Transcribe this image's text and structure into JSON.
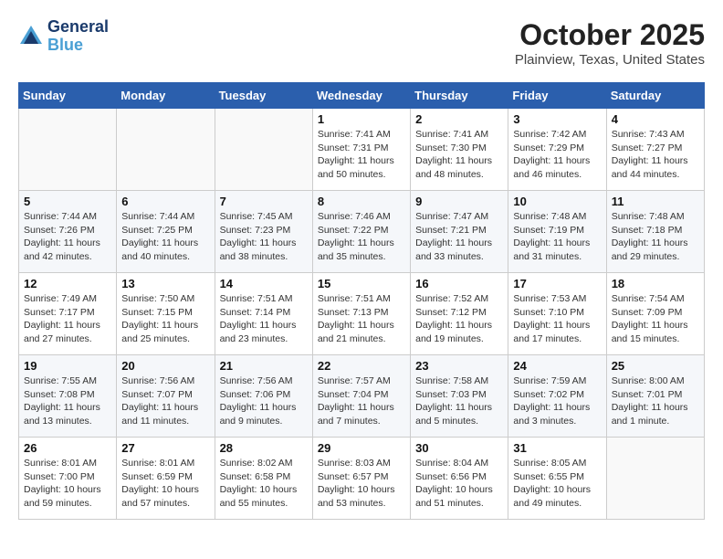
{
  "header": {
    "logo_line1": "General",
    "logo_line2": "Blue",
    "month_title": "October 2025",
    "location": "Plainview, Texas, United States"
  },
  "weekdays": [
    "Sunday",
    "Monday",
    "Tuesday",
    "Wednesday",
    "Thursday",
    "Friday",
    "Saturday"
  ],
  "weeks": [
    [
      {
        "num": "",
        "info": ""
      },
      {
        "num": "",
        "info": ""
      },
      {
        "num": "",
        "info": ""
      },
      {
        "num": "1",
        "info": "Sunrise: 7:41 AM\nSunset: 7:31 PM\nDaylight: 11 hours and 50 minutes."
      },
      {
        "num": "2",
        "info": "Sunrise: 7:41 AM\nSunset: 7:30 PM\nDaylight: 11 hours and 48 minutes."
      },
      {
        "num": "3",
        "info": "Sunrise: 7:42 AM\nSunset: 7:29 PM\nDaylight: 11 hours and 46 minutes."
      },
      {
        "num": "4",
        "info": "Sunrise: 7:43 AM\nSunset: 7:27 PM\nDaylight: 11 hours and 44 minutes."
      }
    ],
    [
      {
        "num": "5",
        "info": "Sunrise: 7:44 AM\nSunset: 7:26 PM\nDaylight: 11 hours and 42 minutes."
      },
      {
        "num": "6",
        "info": "Sunrise: 7:44 AM\nSunset: 7:25 PM\nDaylight: 11 hours and 40 minutes."
      },
      {
        "num": "7",
        "info": "Sunrise: 7:45 AM\nSunset: 7:23 PM\nDaylight: 11 hours and 38 minutes."
      },
      {
        "num": "8",
        "info": "Sunrise: 7:46 AM\nSunset: 7:22 PM\nDaylight: 11 hours and 35 minutes."
      },
      {
        "num": "9",
        "info": "Sunrise: 7:47 AM\nSunset: 7:21 PM\nDaylight: 11 hours and 33 minutes."
      },
      {
        "num": "10",
        "info": "Sunrise: 7:48 AM\nSunset: 7:19 PM\nDaylight: 11 hours and 31 minutes."
      },
      {
        "num": "11",
        "info": "Sunrise: 7:48 AM\nSunset: 7:18 PM\nDaylight: 11 hours and 29 minutes."
      }
    ],
    [
      {
        "num": "12",
        "info": "Sunrise: 7:49 AM\nSunset: 7:17 PM\nDaylight: 11 hours and 27 minutes."
      },
      {
        "num": "13",
        "info": "Sunrise: 7:50 AM\nSunset: 7:15 PM\nDaylight: 11 hours and 25 minutes."
      },
      {
        "num": "14",
        "info": "Sunrise: 7:51 AM\nSunset: 7:14 PM\nDaylight: 11 hours and 23 minutes."
      },
      {
        "num": "15",
        "info": "Sunrise: 7:51 AM\nSunset: 7:13 PM\nDaylight: 11 hours and 21 minutes."
      },
      {
        "num": "16",
        "info": "Sunrise: 7:52 AM\nSunset: 7:12 PM\nDaylight: 11 hours and 19 minutes."
      },
      {
        "num": "17",
        "info": "Sunrise: 7:53 AM\nSunset: 7:10 PM\nDaylight: 11 hours and 17 minutes."
      },
      {
        "num": "18",
        "info": "Sunrise: 7:54 AM\nSunset: 7:09 PM\nDaylight: 11 hours and 15 minutes."
      }
    ],
    [
      {
        "num": "19",
        "info": "Sunrise: 7:55 AM\nSunset: 7:08 PM\nDaylight: 11 hours and 13 minutes."
      },
      {
        "num": "20",
        "info": "Sunrise: 7:56 AM\nSunset: 7:07 PM\nDaylight: 11 hours and 11 minutes."
      },
      {
        "num": "21",
        "info": "Sunrise: 7:56 AM\nSunset: 7:06 PM\nDaylight: 11 hours and 9 minutes."
      },
      {
        "num": "22",
        "info": "Sunrise: 7:57 AM\nSunset: 7:04 PM\nDaylight: 11 hours and 7 minutes."
      },
      {
        "num": "23",
        "info": "Sunrise: 7:58 AM\nSunset: 7:03 PM\nDaylight: 11 hours and 5 minutes."
      },
      {
        "num": "24",
        "info": "Sunrise: 7:59 AM\nSunset: 7:02 PM\nDaylight: 11 hours and 3 minutes."
      },
      {
        "num": "25",
        "info": "Sunrise: 8:00 AM\nSunset: 7:01 PM\nDaylight: 11 hours and 1 minute."
      }
    ],
    [
      {
        "num": "26",
        "info": "Sunrise: 8:01 AM\nSunset: 7:00 PM\nDaylight: 10 hours and 59 minutes."
      },
      {
        "num": "27",
        "info": "Sunrise: 8:01 AM\nSunset: 6:59 PM\nDaylight: 10 hours and 57 minutes."
      },
      {
        "num": "28",
        "info": "Sunrise: 8:02 AM\nSunset: 6:58 PM\nDaylight: 10 hours and 55 minutes."
      },
      {
        "num": "29",
        "info": "Sunrise: 8:03 AM\nSunset: 6:57 PM\nDaylight: 10 hours and 53 minutes."
      },
      {
        "num": "30",
        "info": "Sunrise: 8:04 AM\nSunset: 6:56 PM\nDaylight: 10 hours and 51 minutes."
      },
      {
        "num": "31",
        "info": "Sunrise: 8:05 AM\nSunset: 6:55 PM\nDaylight: 10 hours and 49 minutes."
      },
      {
        "num": "",
        "info": ""
      }
    ]
  ]
}
